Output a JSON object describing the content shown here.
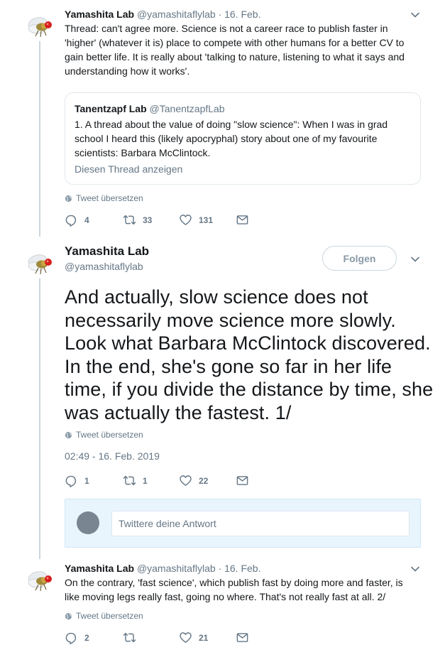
{
  "tweet1": {
    "name": "Yamashita Lab",
    "handle": "@yamashitaflylab",
    "separator": "·",
    "date": "16. Feb.",
    "text": "Thread: can't agree more. Science is not a career race to publish faster in 'higher' (whatever it is) place to compete with other humans for a better CV to gain better life. It is really about 'talking to nature, listening to what it says and understanding how it works'.",
    "quote": {
      "name": "Tanentzapf Lab",
      "handle": "@TanentzapfLab",
      "text": "1. A thread about the value of doing \"slow science\": When I was in grad school I heard this (likely apocryphal) story about one of my favourite scientists: Barbara McClintock.",
      "link": "Diesen Thread anzeigen"
    },
    "translate": "Tweet übersetzen",
    "replies": "4",
    "retweets": "33",
    "likes": "131"
  },
  "tweet2": {
    "name": "Yamashita Lab",
    "handle": "@yamashitaflylab",
    "follow_label": "Folgen",
    "text": "And actually, slow science does not necessarily move science more slowly. Look what Barbara McClintock discovered. In the end, she's gone so far in her life time, if you divide the distance by time, she was actually the fastest. 1/",
    "translate": "Tweet übersetzen",
    "timestamp": "02:49 - 16. Feb. 2019",
    "replies": "1",
    "retweets": "1",
    "likes": "22"
  },
  "reply_box": {
    "placeholder": "Twittere deine Antwort"
  },
  "tweet3": {
    "name": "Yamashita Lab",
    "handle": "@yamashitaflylab",
    "separator": "·",
    "date": "16. Feb.",
    "text": "On the contrary, 'fast science', which publish fast by doing more and faster, is like moving legs really fast, going no where. That's not really fast at all. 2/",
    "translate": "Tweet übersetzen",
    "replies": "2",
    "retweets": "",
    "likes": "21"
  },
  "icons": {
    "reply": "reply-icon",
    "retweet": "retweet-icon",
    "like": "heart-icon",
    "dm": "envelope-icon",
    "translate": "globe-icon",
    "more": "chevron-down-icon",
    "avatar": "fly-avatar"
  },
  "colors": {
    "text": "#14171a",
    "secondary": "#657786",
    "border": "#e1e8ed",
    "reply_bg": "#e8f5fd"
  }
}
